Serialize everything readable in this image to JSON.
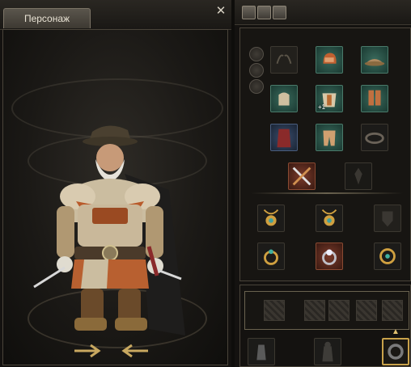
{
  "left_panel": {
    "tab_label": "Персонаж",
    "close_symbol": "✕"
  },
  "right_panel": {
    "top_icons": [
      "person-icon",
      "back-arrow-icon",
      "group-icon"
    ]
  },
  "equipment": {
    "slot_badge": "+1",
    "slots": [
      {
        "name": "slot-earring-left",
        "icon": "ears-icon",
        "state": "empty"
      },
      {
        "name": "slot-helmet",
        "icon": "helmet-icon",
        "state": "equipped"
      },
      {
        "name": "slot-hat",
        "icon": "hat-icon",
        "state": "equipped"
      },
      {
        "name": "slot-gloves",
        "icon": "glove-icon",
        "state": "equipped"
      },
      {
        "name": "slot-chest",
        "icon": "chest-armor-icon",
        "state": "equipped"
      },
      {
        "name": "slot-boots",
        "icon": "boots-icon",
        "state": "equipped"
      },
      {
        "name": "slot-cloak",
        "icon": "cloak-icon",
        "state": "equipped"
      },
      {
        "name": "slot-pants",
        "icon": "pants-icon",
        "state": "equipped"
      },
      {
        "name": "slot-belt",
        "icon": "belt-icon",
        "state": "equipped"
      },
      {
        "name": "slot-weapon",
        "icon": "crossed-swords-icon",
        "state": "equipped"
      },
      {
        "name": "slot-offhand",
        "icon": "emblem-icon",
        "state": "empty"
      },
      {
        "name": "slot-necklace-left",
        "icon": "amulet-icon",
        "state": "equipped"
      },
      {
        "name": "slot-necklace-center",
        "icon": "amulet-icon",
        "state": "equipped"
      },
      {
        "name": "slot-talisman",
        "icon": "shield-emblem-icon",
        "state": "empty"
      },
      {
        "name": "slot-ring-left",
        "icon": "ring-icon",
        "state": "equipped"
      },
      {
        "name": "slot-ring-center",
        "icon": "diamond-ring-icon",
        "state": "equipped"
      },
      {
        "name": "slot-bracelet",
        "icon": "bracelet-icon",
        "state": "equipped"
      }
    ]
  },
  "bag": {
    "slots": [
      "slot-bag-1",
      "slot-bag-2",
      "slot-bag-3",
      "slot-bag-4",
      "slot-bag-5"
    ],
    "bottom_items": [
      "thimble-icon",
      "armor-stand-icon",
      "bracelet-icon"
    ]
  }
}
